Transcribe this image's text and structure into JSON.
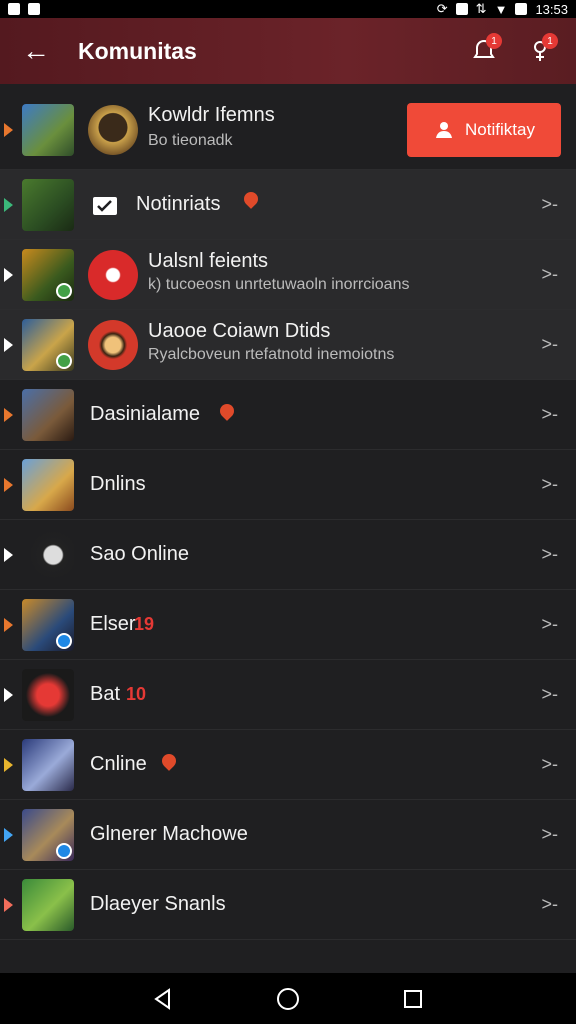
{
  "status_bar": {
    "time": "13:53"
  },
  "app_bar": {
    "title": "Komunitas",
    "badge_1": "1",
    "badge_2": "1"
  },
  "colors": {
    "accent": "#f04a38",
    "appbar": "#6b2329",
    "background": "#1f1f21"
  },
  "header_row": {
    "name": "Kowldr Ifemns",
    "sub": "Bo tieonadk",
    "button_label": "Notifiktay"
  },
  "rows": [
    {
      "name": "Notinriats",
      "chevron": ">-"
    },
    {
      "name": "Ualsnl feients",
      "sub": "k) tucoeosn unrtetuwaoln inorrcioans",
      "chevron": ">-"
    },
    {
      "name": "Uaooe Coiawn Dtids",
      "sub": "Ryalcboveun rtefatnotd inemoiotns",
      "chevron": ">-"
    },
    {
      "name": "Dasinialame",
      "chevron": ">-"
    },
    {
      "name": "Dnlins",
      "chevron": ">-"
    },
    {
      "name": "Sao Online",
      "chevron": ">-"
    },
    {
      "name": "Elser",
      "suffix": "19",
      "chevron": ">-"
    },
    {
      "name": "Bat",
      "suffix": "10",
      "chevron": ">-"
    },
    {
      "name": "Cnline",
      "chevron": ">-"
    },
    {
      "name": "Glnerer Machowe",
      "chevron": ">-"
    },
    {
      "name": "Dlaeyer Snanls",
      "chevron": ">-"
    }
  ]
}
